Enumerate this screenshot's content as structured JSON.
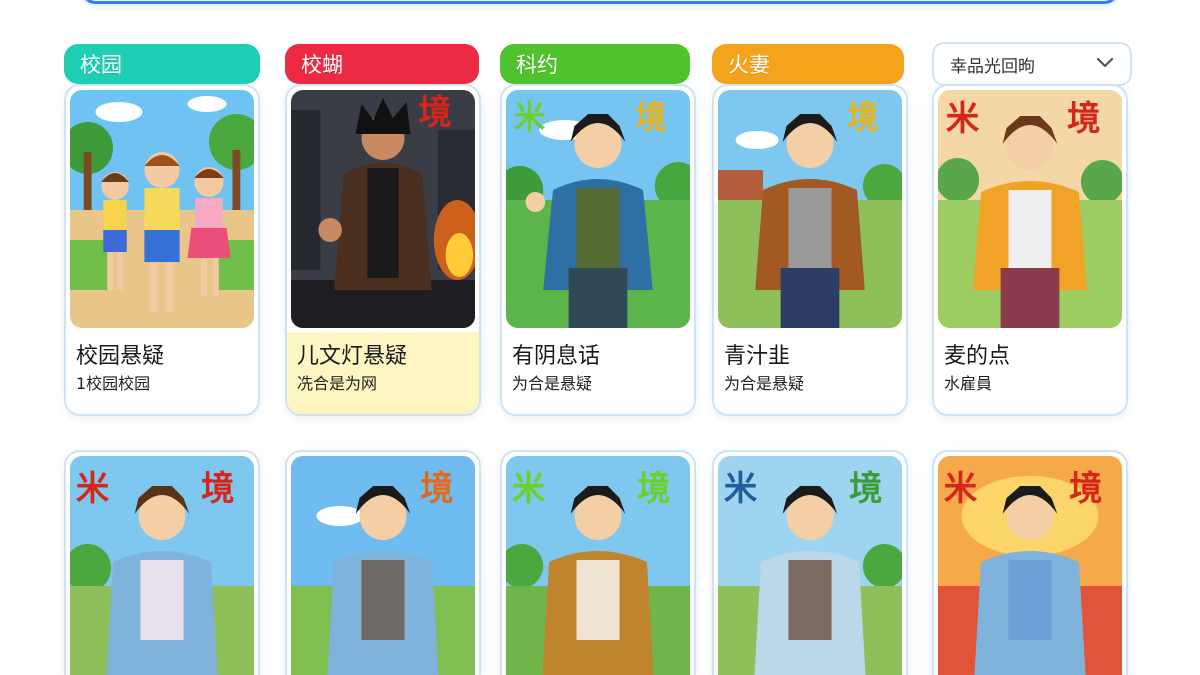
{
  "filters": [
    {
      "label": "校园",
      "color": "#1fcfb5"
    },
    {
      "label": "校蝴",
      "color": "#ec2a44"
    },
    {
      "label": "科约",
      "color": "#4fc32c"
    },
    {
      "label": "火妻",
      "color": "#f4a31a"
    }
  ],
  "sort": {
    "selected": "幸品光回昫",
    "icon": "chevron-down-icon"
  },
  "row1": [
    {
      "title": "校园悬疑",
      "subtitle": "1校园校园",
      "badge_left": "",
      "badge_right": ""
    },
    {
      "title": "儿文灯悬疑",
      "subtitle": "冼合是为网",
      "badge_left": "",
      "badge_right": "境"
    },
    {
      "title": "有阴息话",
      "subtitle": "为合是悬疑",
      "badge_left": "米",
      "badge_right": "境"
    },
    {
      "title": "青汁韭",
      "subtitle": "为合是悬疑",
      "badge_left": "",
      "badge_right": "境"
    },
    {
      "title": "麦的点",
      "subtitle": "水雇員",
      "badge_left": "米",
      "badge_right": "境"
    }
  ],
  "row2": [
    {
      "badge_left": "米",
      "badge_right": "境"
    },
    {
      "badge_left": "",
      "badge_right": "境"
    },
    {
      "badge_left": "米",
      "badge_right": "境"
    },
    {
      "badge_left": "米",
      "badge_right": "境"
    },
    {
      "badge_left": "米",
      "badge_right": "境"
    }
  ]
}
